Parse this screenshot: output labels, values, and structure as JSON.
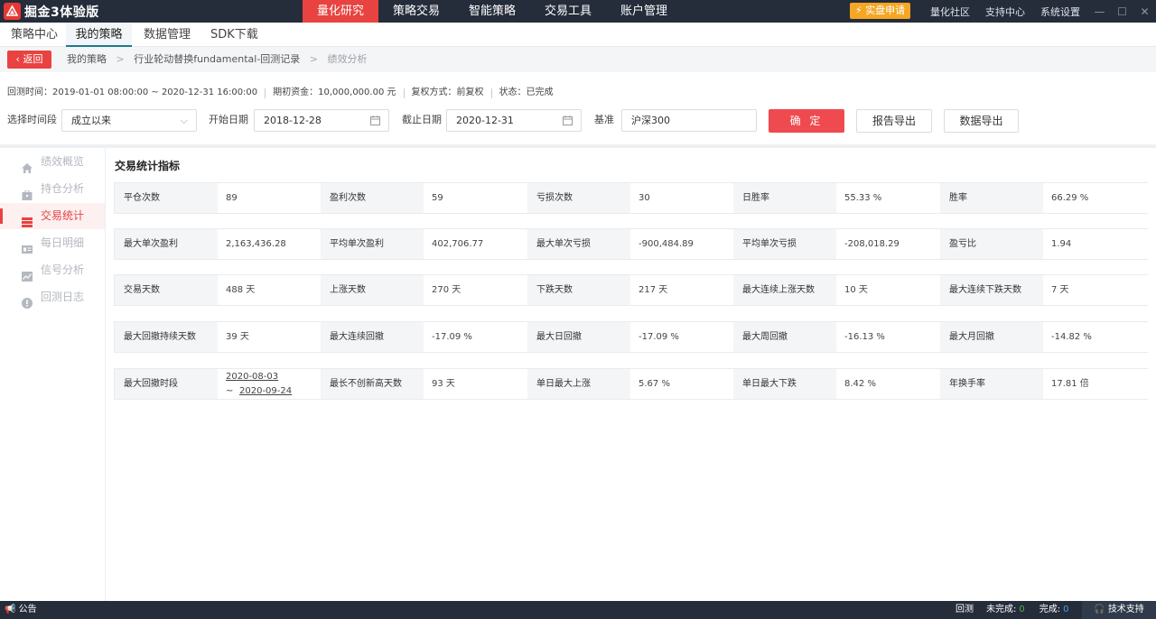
{
  "app": {
    "title": "掘金3体验版"
  },
  "topnav": {
    "items": [
      "量化研究",
      "策略交易",
      "智能策略",
      "交易工具",
      "账户管理"
    ],
    "trial_label": "实盘申请",
    "links": [
      "量化社区",
      "支持中心",
      "系统设置"
    ]
  },
  "subnav": {
    "tabs": [
      "策略中心",
      "我的策略",
      "数据管理",
      "SDK下载"
    ]
  },
  "breadcrumb": {
    "back_label": "返回",
    "items": [
      "我的策略",
      "行业轮动替换fundamental-回测记录",
      "绩效分析"
    ]
  },
  "info": {
    "period": "回测时间：2019-01-01 08:00:00 ~ 2020-12-31 16:00:00",
    "capital": "期初资金：10,000,000.00 元",
    "adjust": "复权方式：前复权",
    "status": "状态：已完成"
  },
  "filters": {
    "period_label": "选择时间段",
    "period_value": "成立以来",
    "start_label": "开始日期",
    "start_value": "2018-12-28",
    "end_label": "截止日期",
    "end_value": "2020-12-31",
    "bench_label": "基准",
    "bench_value": "沪深300",
    "confirm_label": "确 定",
    "report_label": "报告导出",
    "data_label": "数据导出"
  },
  "sidebar": {
    "items": [
      "绩效概览",
      "持仓分析",
      "交易统计",
      "每日明细",
      "信号分析",
      "回测日志"
    ]
  },
  "stats": {
    "title": "交易统计指标",
    "rows": [
      [
        [
          "平仓次数",
          "89"
        ],
        [
          "盈利次数",
          "59"
        ],
        [
          "亏损次数",
          "30"
        ],
        [
          "日胜率",
          "55.33 %"
        ],
        [
          "胜率",
          "66.29 %"
        ]
      ],
      [
        [
          "最大单次盈利",
          "2,163,436.28"
        ],
        [
          "平均单次盈利",
          "402,706.77"
        ],
        [
          "最大单次亏损",
          "-900,484.89"
        ],
        [
          "平均单次亏损",
          "-208,018.29"
        ],
        [
          "盈亏比",
          "1.94"
        ]
      ],
      [
        [
          "交易天数",
          "488 天"
        ],
        [
          "上涨天数",
          "270 天"
        ],
        [
          "下跌天数",
          "217 天"
        ],
        [
          "最大连续上涨天数",
          "10 天"
        ],
        [
          "最大连续下跌天数",
          "7 天"
        ]
      ],
      [
        [
          "最大回撤持续天数",
          "39 天"
        ],
        [
          "最大连续回撤",
          "-17.09 %"
        ],
        [
          "最大日回撤",
          "-17.09 %"
        ],
        [
          "最大周回撤",
          "-16.13 %"
        ],
        [
          "最大月回撤",
          "-14.82 %"
        ]
      ],
      [
        [
          "最大回撤时段",
          ""
        ],
        [
          "最长不创新高天数",
          "93 天"
        ],
        [
          "单日最大上涨",
          "5.67 %"
        ],
        [
          "单日最大下跌",
          "8.42 %"
        ],
        [
          "年换手率",
          "17.81 倍"
        ]
      ]
    ],
    "drawdown_start": "2020-08-03",
    "drawdown_tilde": "~",
    "drawdown_end": "2020-09-24"
  },
  "status": {
    "notice": "公告",
    "backtest": "回测",
    "unfinished_label": "未完成:",
    "unfinished_count": "0",
    "finished_label": "完成:",
    "finished_count": "0",
    "support": "技术支持"
  }
}
